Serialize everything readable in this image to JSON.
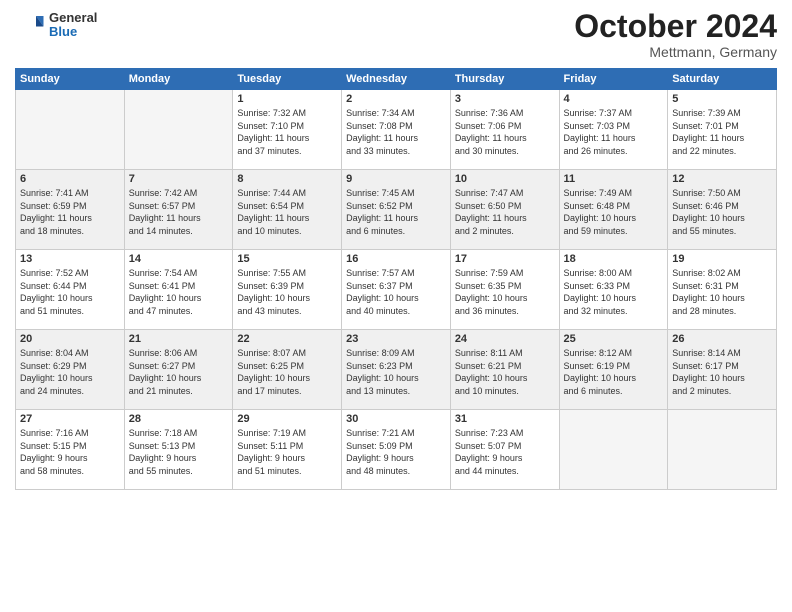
{
  "logo": {
    "general": "General",
    "blue": "Blue"
  },
  "header": {
    "month": "October 2024",
    "location": "Mettmann, Germany"
  },
  "weekdays": [
    "Sunday",
    "Monday",
    "Tuesday",
    "Wednesday",
    "Thursday",
    "Friday",
    "Saturday"
  ],
  "weeks": [
    [
      {
        "day": "",
        "info": ""
      },
      {
        "day": "",
        "info": ""
      },
      {
        "day": "1",
        "info": "Sunrise: 7:32 AM\nSunset: 7:10 PM\nDaylight: 11 hours\nand 37 minutes."
      },
      {
        "day": "2",
        "info": "Sunrise: 7:34 AM\nSunset: 7:08 PM\nDaylight: 11 hours\nand 33 minutes."
      },
      {
        "day": "3",
        "info": "Sunrise: 7:36 AM\nSunset: 7:06 PM\nDaylight: 11 hours\nand 30 minutes."
      },
      {
        "day": "4",
        "info": "Sunrise: 7:37 AM\nSunset: 7:03 PM\nDaylight: 11 hours\nand 26 minutes."
      },
      {
        "day": "5",
        "info": "Sunrise: 7:39 AM\nSunset: 7:01 PM\nDaylight: 11 hours\nand 22 minutes."
      }
    ],
    [
      {
        "day": "6",
        "info": "Sunrise: 7:41 AM\nSunset: 6:59 PM\nDaylight: 11 hours\nand 18 minutes."
      },
      {
        "day": "7",
        "info": "Sunrise: 7:42 AM\nSunset: 6:57 PM\nDaylight: 11 hours\nand 14 minutes."
      },
      {
        "day": "8",
        "info": "Sunrise: 7:44 AM\nSunset: 6:54 PM\nDaylight: 11 hours\nand 10 minutes."
      },
      {
        "day": "9",
        "info": "Sunrise: 7:45 AM\nSunset: 6:52 PM\nDaylight: 11 hours\nand 6 minutes."
      },
      {
        "day": "10",
        "info": "Sunrise: 7:47 AM\nSunset: 6:50 PM\nDaylight: 11 hours\nand 2 minutes."
      },
      {
        "day": "11",
        "info": "Sunrise: 7:49 AM\nSunset: 6:48 PM\nDaylight: 10 hours\nand 59 minutes."
      },
      {
        "day": "12",
        "info": "Sunrise: 7:50 AM\nSunset: 6:46 PM\nDaylight: 10 hours\nand 55 minutes."
      }
    ],
    [
      {
        "day": "13",
        "info": "Sunrise: 7:52 AM\nSunset: 6:44 PM\nDaylight: 10 hours\nand 51 minutes."
      },
      {
        "day": "14",
        "info": "Sunrise: 7:54 AM\nSunset: 6:41 PM\nDaylight: 10 hours\nand 47 minutes."
      },
      {
        "day": "15",
        "info": "Sunrise: 7:55 AM\nSunset: 6:39 PM\nDaylight: 10 hours\nand 43 minutes."
      },
      {
        "day": "16",
        "info": "Sunrise: 7:57 AM\nSunset: 6:37 PM\nDaylight: 10 hours\nand 40 minutes."
      },
      {
        "day": "17",
        "info": "Sunrise: 7:59 AM\nSunset: 6:35 PM\nDaylight: 10 hours\nand 36 minutes."
      },
      {
        "day": "18",
        "info": "Sunrise: 8:00 AM\nSunset: 6:33 PM\nDaylight: 10 hours\nand 32 minutes."
      },
      {
        "day": "19",
        "info": "Sunrise: 8:02 AM\nSunset: 6:31 PM\nDaylight: 10 hours\nand 28 minutes."
      }
    ],
    [
      {
        "day": "20",
        "info": "Sunrise: 8:04 AM\nSunset: 6:29 PM\nDaylight: 10 hours\nand 24 minutes."
      },
      {
        "day": "21",
        "info": "Sunrise: 8:06 AM\nSunset: 6:27 PM\nDaylight: 10 hours\nand 21 minutes."
      },
      {
        "day": "22",
        "info": "Sunrise: 8:07 AM\nSunset: 6:25 PM\nDaylight: 10 hours\nand 17 minutes."
      },
      {
        "day": "23",
        "info": "Sunrise: 8:09 AM\nSunset: 6:23 PM\nDaylight: 10 hours\nand 13 minutes."
      },
      {
        "day": "24",
        "info": "Sunrise: 8:11 AM\nSunset: 6:21 PM\nDaylight: 10 hours\nand 10 minutes."
      },
      {
        "day": "25",
        "info": "Sunrise: 8:12 AM\nSunset: 6:19 PM\nDaylight: 10 hours\nand 6 minutes."
      },
      {
        "day": "26",
        "info": "Sunrise: 8:14 AM\nSunset: 6:17 PM\nDaylight: 10 hours\nand 2 minutes."
      }
    ],
    [
      {
        "day": "27",
        "info": "Sunrise: 7:16 AM\nSunset: 5:15 PM\nDaylight: 9 hours\nand 58 minutes."
      },
      {
        "day": "28",
        "info": "Sunrise: 7:18 AM\nSunset: 5:13 PM\nDaylight: 9 hours\nand 55 minutes."
      },
      {
        "day": "29",
        "info": "Sunrise: 7:19 AM\nSunset: 5:11 PM\nDaylight: 9 hours\nand 51 minutes."
      },
      {
        "day": "30",
        "info": "Sunrise: 7:21 AM\nSunset: 5:09 PM\nDaylight: 9 hours\nand 48 minutes."
      },
      {
        "day": "31",
        "info": "Sunrise: 7:23 AM\nSunset: 5:07 PM\nDaylight: 9 hours\nand 44 minutes."
      },
      {
        "day": "",
        "info": ""
      },
      {
        "day": "",
        "info": ""
      }
    ]
  ]
}
